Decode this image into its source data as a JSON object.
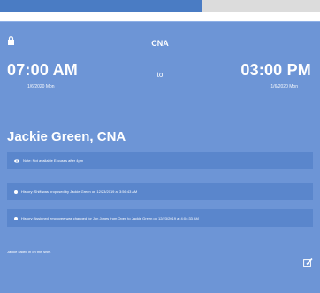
{
  "shift": {
    "role_top": "CNA",
    "start_time": "07:00 AM",
    "start_date": "1/6/2020  Mon",
    "to_label": "to",
    "end_time": "03:00 PM",
    "end_date": "1/6/2020  Mon"
  },
  "employee": {
    "name": "Jackie Green, CNA"
  },
  "notes": [
    {
      "text": "Note: Not available Excuses after 4pm",
      "icon": "eye-icon"
    },
    {
      "text": "History: Shift was proposed by Jackie Green on 12/23/2019 at 3:56:43 AM",
      "icon": "info-icon"
    },
    {
      "text": "History: Assigned employee was changed for Jon Jones from Open to Jackie Green on 12/23/2019 at 4:04:33 AM",
      "icon": "info-icon"
    }
  ],
  "footer": {
    "text": "Jackie called in on this shift."
  },
  "colors": {
    "card_bg": "#6d95d6",
    "note_bg": "#5a86cc",
    "topbar_active": "#4a7cc4",
    "topbar_inactive": "#dcdcdc"
  }
}
